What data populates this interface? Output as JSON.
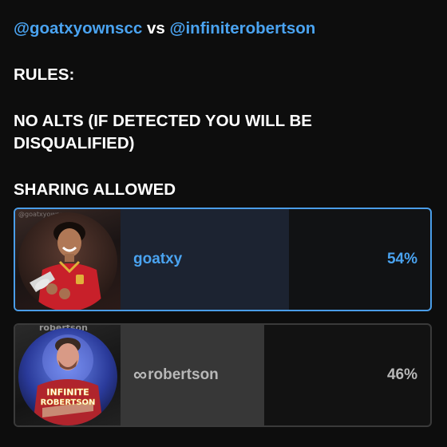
{
  "post": {
    "mention_1": "@goatxyownscc",
    "vs": "vs",
    "mention_2": "@infiniterobertson",
    "rules_heading": "RULES:",
    "rule_1": "NO ALTS (IF DETECTED YOU WILL BE DISQUALIFIED)",
    "rule_2": "SHARING ALLOWED"
  },
  "poll": {
    "options": [
      {
        "label": "goatxy",
        "percent_text": "54%",
        "percent": 54,
        "selected": true,
        "avatar_icon": "player-photo-red-kit",
        "avatar_watermark": "@goatxyownscc"
      },
      {
        "label_prefix": "∞",
        "label": "robertson",
        "percent_text": "46%",
        "percent": 46,
        "selected": false,
        "avatar_icon": "player-edit-photo",
        "avatar_watermark": "robertson"
      }
    ]
  },
  "colors": {
    "accent": "#4aa3f0",
    "background": "#0d0d0d",
    "selected_border": "#4a9de8",
    "selected_bar": "#1c2331",
    "unselected_bar": "#373737",
    "unselected_text": "#b8b8b8"
  }
}
